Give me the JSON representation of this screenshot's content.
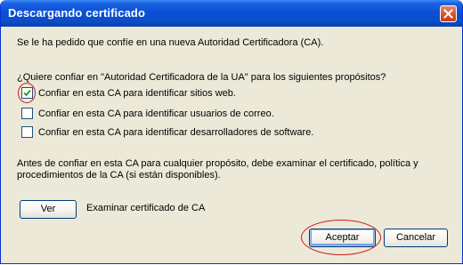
{
  "window": {
    "title": "Descargando certificado",
    "close_icon": "close-icon"
  },
  "intro": "Se le ha pedido que confíe en una nueva Autoridad Certificadora (CA).",
  "question": "¿Quiere confiar en \"Autoridad Certificadora de la UA\" para los siguientes propósitos?",
  "options": [
    {
      "label": "Confiar en esta CA para identificar sitios web.",
      "checked": true
    },
    {
      "label": "Confiar en esta CA para identificar usuarios de correo.",
      "checked": false
    },
    {
      "label": "Confiar en esta CA para identificar desarrolladores de software.",
      "checked": false
    }
  ],
  "note_line1": "Antes de confiar en esta CA para cualquier propósito, debe examinar el certificado, política y",
  "note_line2": "procedimientos de la CA (si están disponibles).",
  "view": {
    "button": "Ver",
    "label": "Examinar certificado de CA"
  },
  "buttons": {
    "accept": "Aceptar",
    "cancel": "Cancelar"
  },
  "colors": {
    "titlebar": "#0a4fd6",
    "annotation": "#d21a1a",
    "dialog_bg": "#ece9d8"
  }
}
